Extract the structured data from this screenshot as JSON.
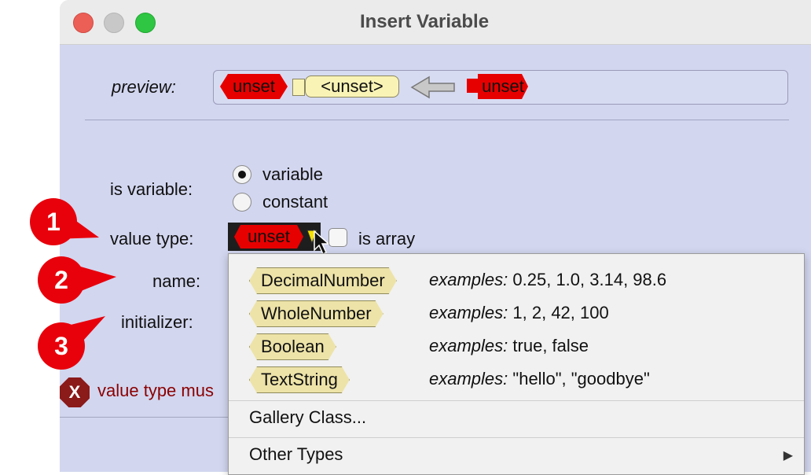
{
  "window": {
    "title": "Insert Variable"
  },
  "preview": {
    "label": "preview:",
    "left_tile": "unset",
    "value_tile": "<unset>",
    "right_tile": "unset"
  },
  "is_variable": {
    "label": "is variable:",
    "options": [
      {
        "label": "variable",
        "selected": true
      },
      {
        "label": "constant",
        "selected": false
      }
    ]
  },
  "value_type": {
    "label": "value type:",
    "selected": "unset",
    "is_array_label": "is array",
    "is_array_checked": false
  },
  "name": {
    "label": "name:"
  },
  "initializer": {
    "label": "initializer:"
  },
  "error": {
    "icon": "X",
    "text": "value type mus"
  },
  "dropdown": {
    "types": [
      {
        "name": "DecimalNumber",
        "examples_label": "examples:",
        "examples": "0.25, 1.0, 3.14, 98.6"
      },
      {
        "name": "WholeNumber",
        "examples_label": "examples:",
        "examples": "1, 2, 42, 100"
      },
      {
        "name": "Boolean",
        "examples_label": "examples:",
        "examples": "true, false"
      },
      {
        "name": "TextString",
        "examples_label": "examples:",
        "examples": "\"hello\", \"goodbye\""
      }
    ],
    "gallery_class": "Gallery Class...",
    "other_types": "Other Types",
    "other_types_icon": "submenu-arrow-icon"
  },
  "callouts": [
    "1",
    "2",
    "3"
  ],
  "colors": {
    "callout_red": "#e8000b",
    "unset_red": "#e60000",
    "dialog_bg": "#d2d6ef",
    "type_tile": "#ede3a8",
    "error_text": "#8b0000"
  }
}
